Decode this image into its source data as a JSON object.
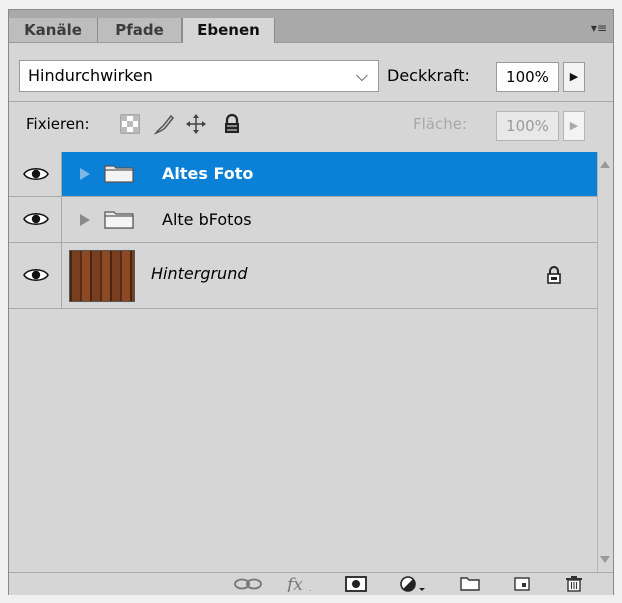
{
  "tabs": [
    "Kanäle",
    "Pfade",
    "Ebenen"
  ],
  "blend": {
    "mode": "Hindurchwirken",
    "opacity_label": "Deckkraft:",
    "opacity_value": "100%"
  },
  "lock": {
    "label": "Fixieren:",
    "fill_label": "Fläche:",
    "fill_value": "100%"
  },
  "layers": [
    {
      "name": "Altes Foto",
      "type": "group",
      "selected": true,
      "visible": true
    },
    {
      "name": "Alte bFotos",
      "type": "group",
      "selected": false,
      "visible": true
    },
    {
      "name": "Hintergrund",
      "type": "background",
      "selected": false,
      "visible": true,
      "locked": true
    }
  ],
  "footer_icons": [
    "link-layers-icon",
    "fx-icon",
    "add-mask-icon",
    "adjustment-layer-icon",
    "new-group-icon",
    "new-layer-icon",
    "trash-icon"
  ],
  "colors": {
    "selection": "#0a81d6",
    "panel": "#d6d6d6"
  }
}
